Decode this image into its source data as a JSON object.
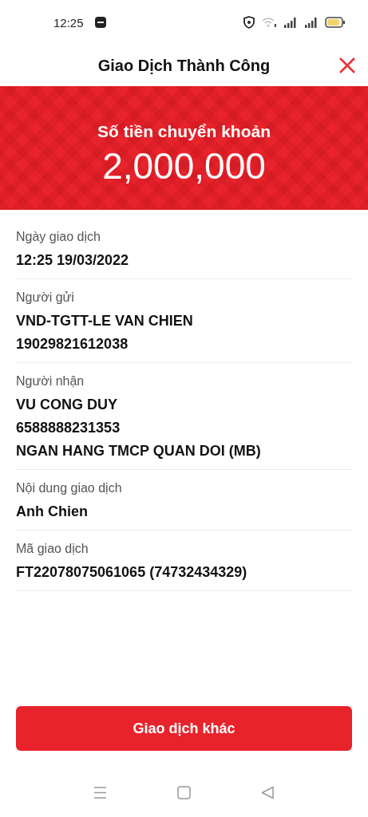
{
  "status_bar": {
    "time": "12:25"
  },
  "header": {
    "title": "Giao Dịch Thành Công"
  },
  "banner": {
    "label": "Số tiền chuyển khoản",
    "amount": "2,000,000"
  },
  "details": [
    {
      "label": "Ngày giao dịch",
      "values": [
        "12:25 19/03/2022"
      ]
    },
    {
      "label": "Người gửi",
      "values": [
        "VND-TGTT-LE VAN CHIEN",
        "19029821612038"
      ]
    },
    {
      "label": "Người nhận",
      "values": [
        "VU CONG DUY",
        "6588888231353",
        "NGAN HANG TMCP QUAN DOI (MB)"
      ]
    },
    {
      "label": "Nội dung giao dịch",
      "values": [
        "Anh Chien"
      ]
    },
    {
      "label": "Mã giao dịch",
      "values": [
        "FT22078075061065 (74732434329)"
      ]
    }
  ],
  "button": {
    "label": "Giao dịch khác"
  }
}
